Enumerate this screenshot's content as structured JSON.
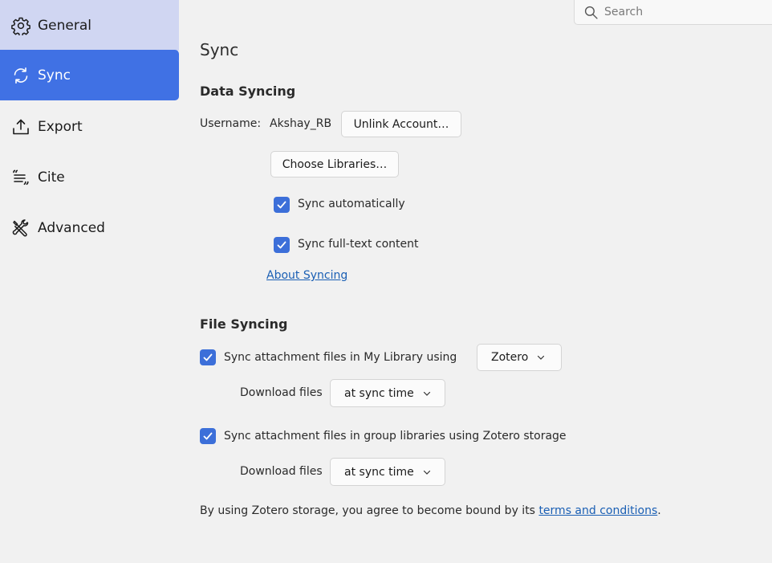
{
  "sidebar": {
    "items": [
      {
        "label": "General",
        "icon": "gear-icon"
      },
      {
        "label": "Sync",
        "icon": "sync-icon"
      },
      {
        "label": "Export",
        "icon": "export-icon"
      },
      {
        "label": "Cite",
        "icon": "cite-icon"
      },
      {
        "label": "Advanced",
        "icon": "tools-icon"
      }
    ],
    "selected": "Sync"
  },
  "search": {
    "placeholder": "Search"
  },
  "pane": {
    "title": "Sync",
    "data_syncing": {
      "title": "Data Syncing",
      "username_label": "Username:",
      "username_value": "Akshay_RB",
      "unlink_button": "Unlink Account…",
      "choose_libraries_button": "Choose Libraries…",
      "sync_automatically": {
        "label": "Sync automatically",
        "checked": true
      },
      "sync_fulltext": {
        "label": "Sync full-text content",
        "checked": true
      },
      "about_link": "About Syncing"
    },
    "file_syncing": {
      "title": "File Syncing",
      "my_library": {
        "label": "Sync attachment files in My Library using",
        "checked": true,
        "service": "Zotero",
        "download_label": "Download files",
        "download_value": "at sync time"
      },
      "group_libraries": {
        "label": "Sync attachment files in group libraries using Zotero storage",
        "checked": true,
        "download_label": "Download files",
        "download_value": "at sync time"
      },
      "footer_prefix": "By using Zotero storage, you agree to become bound by its ",
      "footer_link": "terms and conditions",
      "footer_suffix": "."
    }
  },
  "colors": {
    "accent": "#4071e4",
    "hover": "#d0d6f2",
    "checkbox": "#3c6fd9",
    "link": "#1a5fb4"
  }
}
